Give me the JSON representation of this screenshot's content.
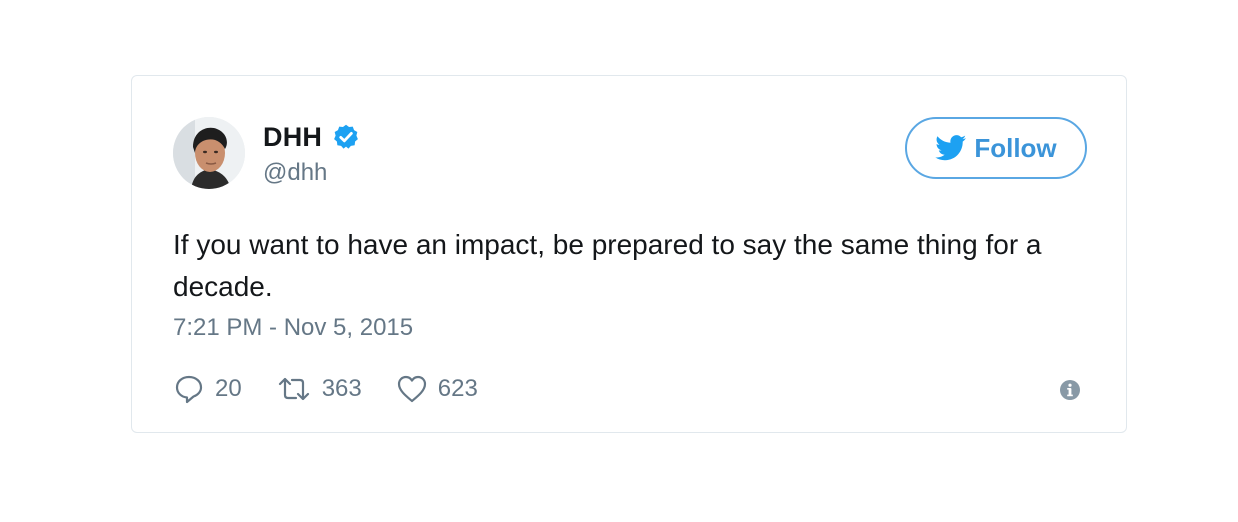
{
  "tweet": {
    "author_name": "DHH",
    "author_handle": "@dhh",
    "verified": true,
    "follow_label": "Follow",
    "text": "If you want to have an impact, be prepared to say the same thing for a decade.",
    "timestamp": "7:21 PM - Nov 5, 2015",
    "replies": "20",
    "retweets": "363",
    "likes": "623"
  },
  "colors": {
    "accent": "#1da1f2",
    "follow_border": "#5aa7e3",
    "follow_text": "#3b94d9",
    "secondary_text": "#657786",
    "primary_text": "#14171a",
    "card_border": "#e1e8ed"
  },
  "icons": [
    "avatar",
    "verified-badge-icon",
    "twitter-bird-icon",
    "reply-icon",
    "retweet-icon",
    "heart-icon",
    "info-icon"
  ]
}
